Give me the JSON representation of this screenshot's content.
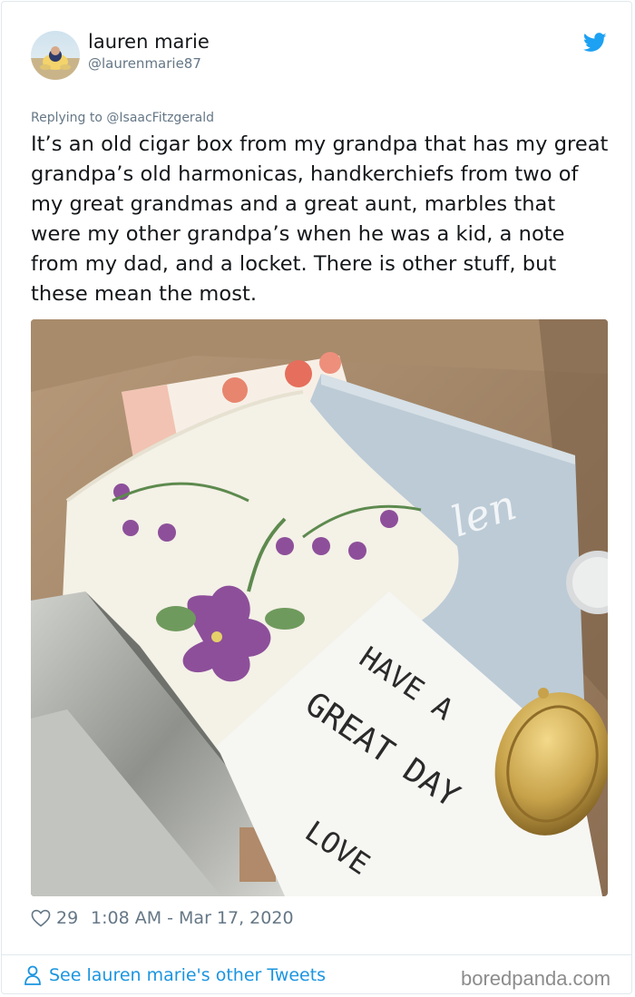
{
  "tweet": {
    "author_name": "lauren marie",
    "author_handle": "@laurenmarie87",
    "reply_prefix": "Replying to",
    "reply_to": "@IsaacFitzgerald",
    "text": "It’s an old cigar box from my grandpa that has my great grandpa’s old harmonicas, handkerchiefs from two of my great grandmas and a great aunt, marbles that were my other grandpa’s when he was a kid, a note from my dad, and a locket. There is other stuff, but these mean the most.",
    "likes": "29",
    "timestamp": "1:08 AM - Mar 17, 2020"
  },
  "photo": {
    "note_lines": [
      "HAVE A",
      "GREAT DAY",
      "LOVE"
    ],
    "embroidery": "len"
  },
  "footer": {
    "see_more": "See lauren marie's other Tweets",
    "watermark": "boredpanda.com"
  },
  "icons": {
    "brand": "twitter-bird-icon",
    "like": "heart-icon",
    "profile": "person-icon"
  },
  "colors": {
    "link": "#1b95e0",
    "muted": "#657786",
    "twitter_blue": "#1da1f2",
    "divider": "#e1e8ed"
  }
}
